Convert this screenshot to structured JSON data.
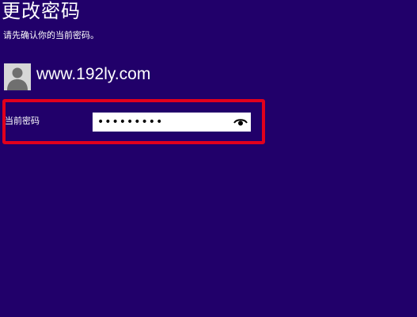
{
  "page": {
    "title": "更改密码",
    "subtitle": "请先确认你的当前密码。",
    "background_color": "#21006a"
  },
  "account": {
    "name": "www.192ly.com",
    "avatar_icon": "user-avatar-icon"
  },
  "form": {
    "current_password_label": "当前密码",
    "current_password_value": "•••••••••",
    "reveal_icon": "eye-icon"
  },
  "annotation": {
    "highlight_color": "#e2001c"
  }
}
